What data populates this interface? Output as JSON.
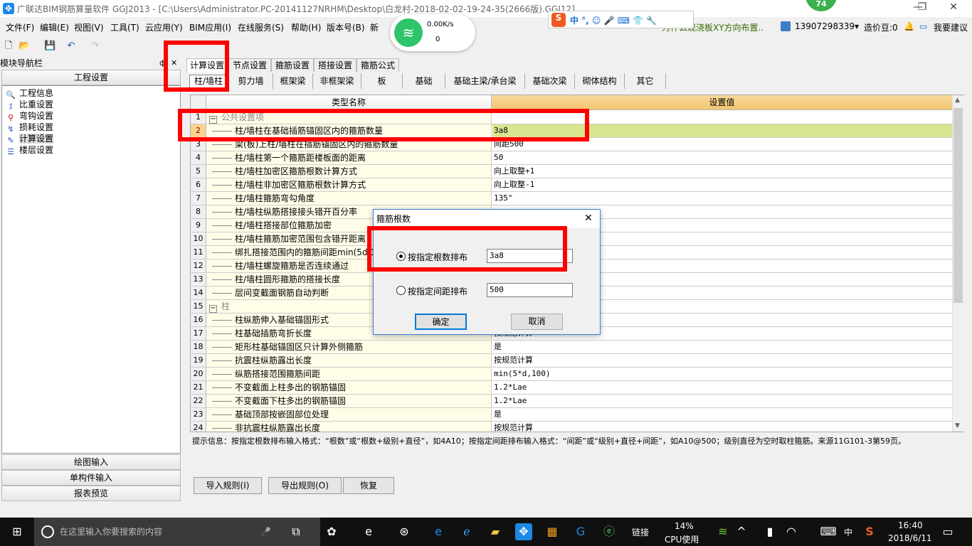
{
  "window": {
    "title": "广联达BIM钢筋算量软件 GGJ2013 - [C:\\Users\\Administrator.PC-20141127NRHM\\Desktop\\白龙村-2018-02-02-19-24-35(2666版).GGJ12]",
    "badge": "74"
  },
  "menu": [
    "文件(F)",
    "编辑(E)",
    "视图(V)",
    "工具(T)",
    "云应用(Y)",
    "BIM应用(I)",
    "在线服务(S)",
    "帮助(H)",
    "版本号(B)",
    "新"
  ],
  "topbar": {
    "notice": "为什么现浇板XY方向布置..",
    "user": "13907298339",
    "beans": "造价豆:0",
    "suggest": "我要建议"
  },
  "network": {
    "speed": "0.00K/s",
    "count": "0"
  },
  "nav": {
    "title": "模块导航栏",
    "section": "工程设置",
    "items": [
      "工程信息",
      "比重设置",
      "弯钩设置",
      "损耗设置",
      "计算设置",
      "楼层设置"
    ],
    "selected": 4,
    "bottom": [
      "绘图输入",
      "单构件输入",
      "报表预览"
    ]
  },
  "tabs": [
    "计算设置",
    "节点设置",
    "箍筋设置",
    "搭接设置",
    "箍筋公式"
  ],
  "subtabs": [
    "柱/墙柱",
    "剪力墙",
    "框架梁",
    "非框架梁",
    "板",
    "基础",
    "基础主梁/承台梁",
    "基础次梁",
    "砌体结构",
    "其它"
  ],
  "grid": {
    "headers": [
      "类型名称",
      "设置值"
    ],
    "rows": [
      {
        "n": "1",
        "name": "公共设置项",
        "value": "",
        "group": true
      },
      {
        "n": "2",
        "name": "柱/墙柱在基础插筋锚固区内的箍筋数量",
        "value": "3a8"
      },
      {
        "n": "3",
        "name": "梁(板)上柱/墙柱在插筋锚固区内的箍筋数量",
        "value": "间距500"
      },
      {
        "n": "4",
        "name": "柱/墙柱第一个箍筋距楼板面的距离",
        "value": "50"
      },
      {
        "n": "5",
        "name": "柱/墙柱加密区箍筋根数计算方式",
        "value": "向上取整+1"
      },
      {
        "n": "6",
        "name": "柱/墙柱非加密区箍筋根数计算方式",
        "value": "向上取整-1"
      },
      {
        "n": "7",
        "name": "柱/墙柱箍筋弯勾角度",
        "value": "135°"
      },
      {
        "n": "8",
        "name": "柱/墙柱纵筋搭接接头错开百分率",
        "value": ""
      },
      {
        "n": "9",
        "name": "柱/墙柱搭接部位箍筋加密",
        "value": ""
      },
      {
        "n": "10",
        "name": "柱/墙柱箍筋加密范围包含错开距离",
        "value": ""
      },
      {
        "n": "11",
        "name": "绑扎搭接范围内的箍筋间距min(5d,100)",
        "value": ""
      },
      {
        "n": "12",
        "name": "柱/墙柱螺旋箍筋是否连续通过",
        "value": ""
      },
      {
        "n": "13",
        "name": "柱/墙柱圆形箍筋的搭接长度",
        "value": ""
      },
      {
        "n": "14",
        "name": "层间变截面钢筋自动判断",
        "value": ""
      },
      {
        "n": "15",
        "name": "柱",
        "value": "",
        "group": true
      },
      {
        "n": "16",
        "name": "柱纵筋伸入基础锚固形式",
        "value": ""
      },
      {
        "n": "17",
        "name": "柱基础插筋弯折长度",
        "value": "按规范计算"
      },
      {
        "n": "18",
        "name": "矩形柱基础锚固区只计算外侧箍筋",
        "value": "是"
      },
      {
        "n": "19",
        "name": "抗震柱纵筋露出长度",
        "value": "按规范计算"
      },
      {
        "n": "20",
        "name": "纵筋搭接范围箍筋间距",
        "value": "min(5*d,100)"
      },
      {
        "n": "21",
        "name": "不变截面上柱多出的钢筋锚固",
        "value": "1.2*Lae"
      },
      {
        "n": "22",
        "name": "不变截面下柱多出的钢筋锚固",
        "value": "1.2*Lae"
      },
      {
        "n": "23",
        "name": "基础顶部按嵌固部位处理",
        "value": "是"
      },
      {
        "n": "24",
        "name": "非抗震柱纵筋露出长度",
        "value": "按规范计算"
      }
    ]
  },
  "hint": "提示信息：按指定根数排布输入格式：“根数”或“根数+级别+直径”，如4A10；按指定间距排布输入格式：“间距”或“级别+直径+间距”，如A10@500；级别直径为空时取柱箍筋。来源11G101-3第59页。",
  "buttons": {
    "import": "导入规则(I)",
    "export": "导出规则(O)",
    "restore": "恢复"
  },
  "dialog": {
    "title": "箍筋根数",
    "opt1": "按指定根数排布",
    "val1": "3a8",
    "opt2": "按指定间距排布",
    "val2": "500",
    "ok": "确定",
    "cancel": "取消",
    "selected": "opt1"
  },
  "taskbar": {
    "search_placeholder": "在这里输入你要搜索的内容",
    "link": "链接",
    "cpu": "14%",
    "cpu_label": "CPU使用",
    "ime": "中",
    "time": "16:40",
    "date": "2018/6/11"
  },
  "colors": {
    "selected_row": "#d8e58e",
    "header_value": "#f5c97a",
    "annotation": "#ff0000"
  }
}
